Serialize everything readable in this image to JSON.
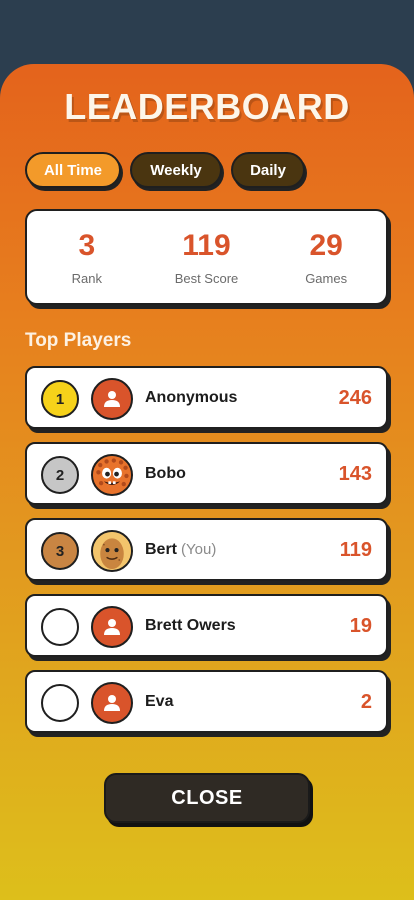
{
  "header": {
    "title": "LEADERBOARD"
  },
  "tabs": [
    {
      "label": "All Time",
      "active": true
    },
    {
      "label": "Weekly",
      "active": false
    },
    {
      "label": "Daily",
      "active": false
    }
  ],
  "stats": [
    {
      "value": "3",
      "label": "Rank"
    },
    {
      "value": "119",
      "label": "Best Score"
    },
    {
      "value": "29",
      "label": "Games"
    }
  ],
  "section_title": "Top Players",
  "players": [
    {
      "rank": "1",
      "name": "Anonymous",
      "suffix": "",
      "score": "246",
      "medal": "#f6d21a",
      "avatar": "user-icon"
    },
    {
      "rank": "2",
      "name": "Bobo",
      "suffix": "",
      "score": "143",
      "medal": "#c6c6c6",
      "avatar": "monster-avatar"
    },
    {
      "rank": "3",
      "name": "Bert",
      "suffix": "(You)",
      "score": "119",
      "medal": "#c98543",
      "avatar": "potato-avatar"
    },
    {
      "rank": "",
      "name": "Brett Owers",
      "suffix": "",
      "score": "19",
      "medal": "#ffffff",
      "avatar": "user-icon"
    },
    {
      "rank": "",
      "name": "Eva",
      "suffix": "",
      "score": "2",
      "medal": "#ffffff",
      "avatar": "user-icon"
    }
  ],
  "close_button": {
    "label": "CLOSE"
  },
  "colors": {
    "accent": "#d9542b",
    "tab_active": "#f39a2a",
    "tab_inactive": "#4a3510"
  }
}
